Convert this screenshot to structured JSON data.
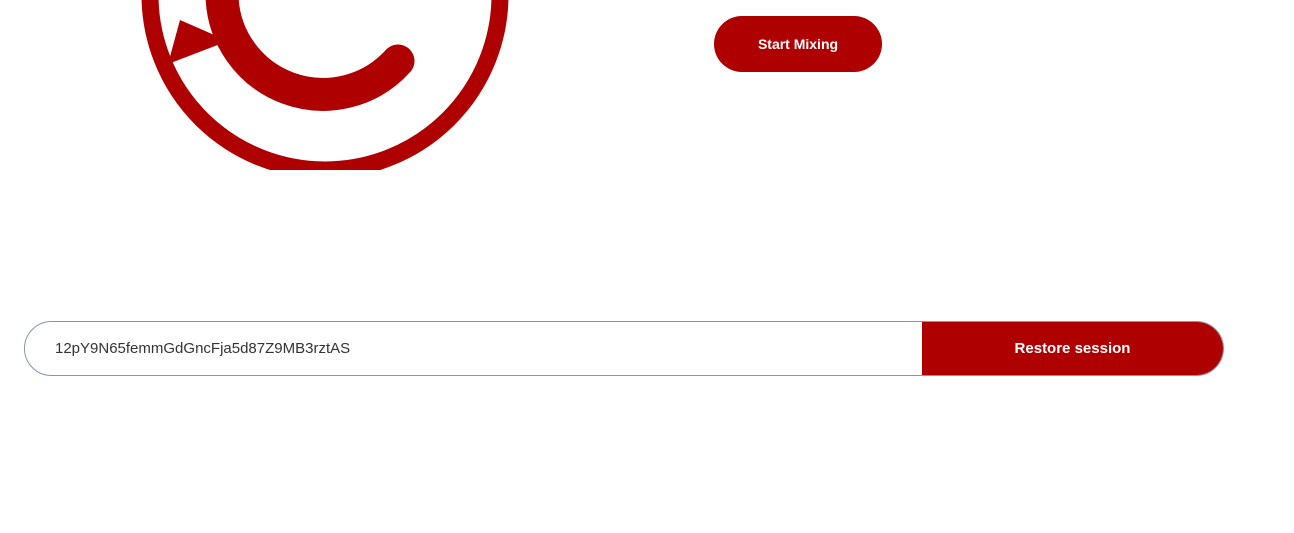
{
  "colors": {
    "brand": "#ae0000",
    "input_border": "#8597ad",
    "input_text": "#333333"
  },
  "logo": {
    "icon": "refresh-arrow-circle-icon"
  },
  "start_button": {
    "label": "Start Mixing"
  },
  "restore": {
    "input_value": "12pY9N65femmGdGncFja5d87Z9MB3rztAS",
    "button_label": "Restore session"
  }
}
